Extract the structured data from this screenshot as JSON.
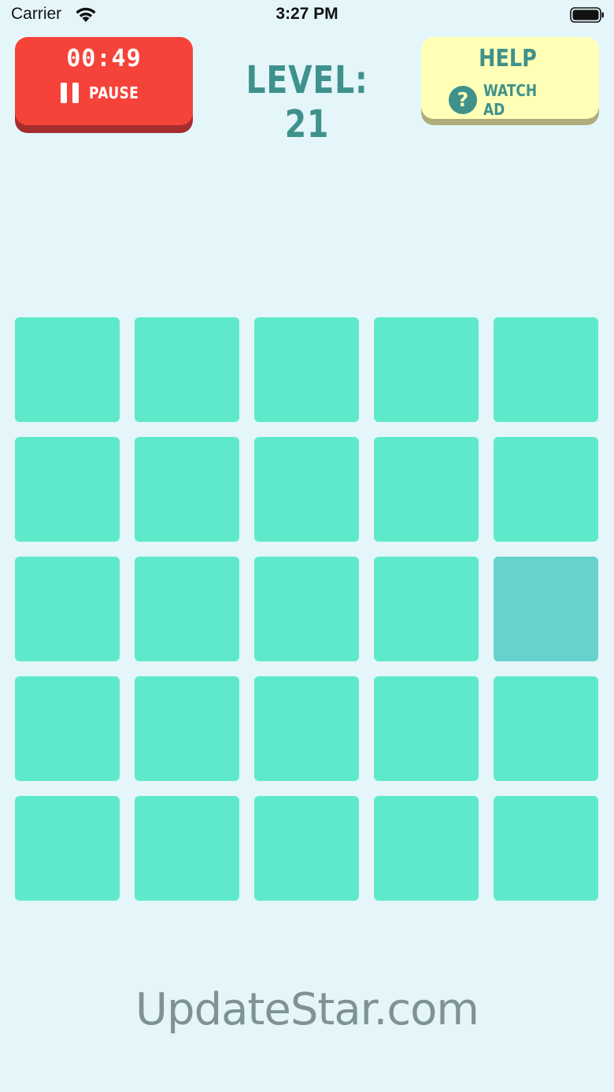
{
  "status_bar": {
    "carrier": "Carrier",
    "time": "3:27 PM",
    "wifi_icon": "wifi-icon",
    "battery_icon": "battery-icon"
  },
  "header": {
    "timer": "00:49",
    "pause_label": "PAUSE",
    "pause_icon": "pause-icon",
    "level_label": "LEVEL: 21",
    "help_title": "HELP",
    "watch_ad_label": "WATCH AD",
    "help_icon": "question-icon"
  },
  "colors": {
    "background": "#e4f6fa",
    "timer_button": "#f6433a",
    "help_button": "#ffffb8",
    "level_text": "#3f918c",
    "tile": "#5eeaca",
    "odd_tile": "#67d2cc"
  },
  "grid": {
    "rows": 5,
    "cols": 5,
    "odd_tile": {
      "row": 2,
      "col": 4
    }
  },
  "watermark": "UpdateStar.com"
}
